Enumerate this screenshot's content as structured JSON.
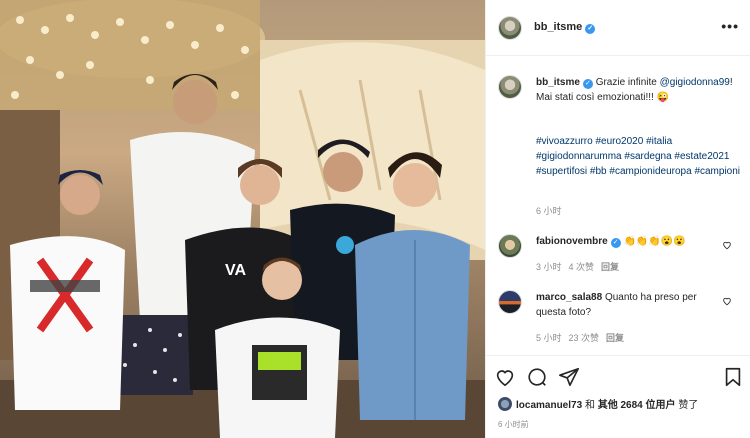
{
  "post": {
    "username": "bb_itsme",
    "more_label": "•••",
    "caption": {
      "username": "bb_itsme",
      "text_before": "Grazie infinite",
      "mention": "@gigiodonna99",
      "text_after": "! Mai stati così emozionati!!! 😜",
      "hashtags": "#vivoazzurro #euro2020 #italia #gigiodonnarumma #sardegna #estate2021 #supertifosi #bb #campionideuropa #campioni",
      "time": "6 小时"
    },
    "comments": [
      {
        "username": "fabionovembre",
        "text": "👏👏👏😮😮",
        "time": "3 小时",
        "likes": "4 次赞",
        "reply": "回复"
      },
      {
        "username": "marco_sala88",
        "text": "Quanto ha preso per questa foto?",
        "time": "5 小时",
        "likes": "23 次赞",
        "reply": "回复"
      }
    ],
    "liked_by": {
      "user": "locamanuel73",
      "middle": "和",
      "others": "其他 2684 位用户",
      "suffix": "赞了"
    },
    "posted_time": "6 小时前"
  },
  "icons": [
    "heart-icon",
    "comment-icon",
    "share-icon",
    "bookmark-icon",
    "verified-icon",
    "more-icon"
  ],
  "colors": {
    "link": "#00376b",
    "verified": "#3897f0",
    "meta": "#8e8e8e"
  }
}
